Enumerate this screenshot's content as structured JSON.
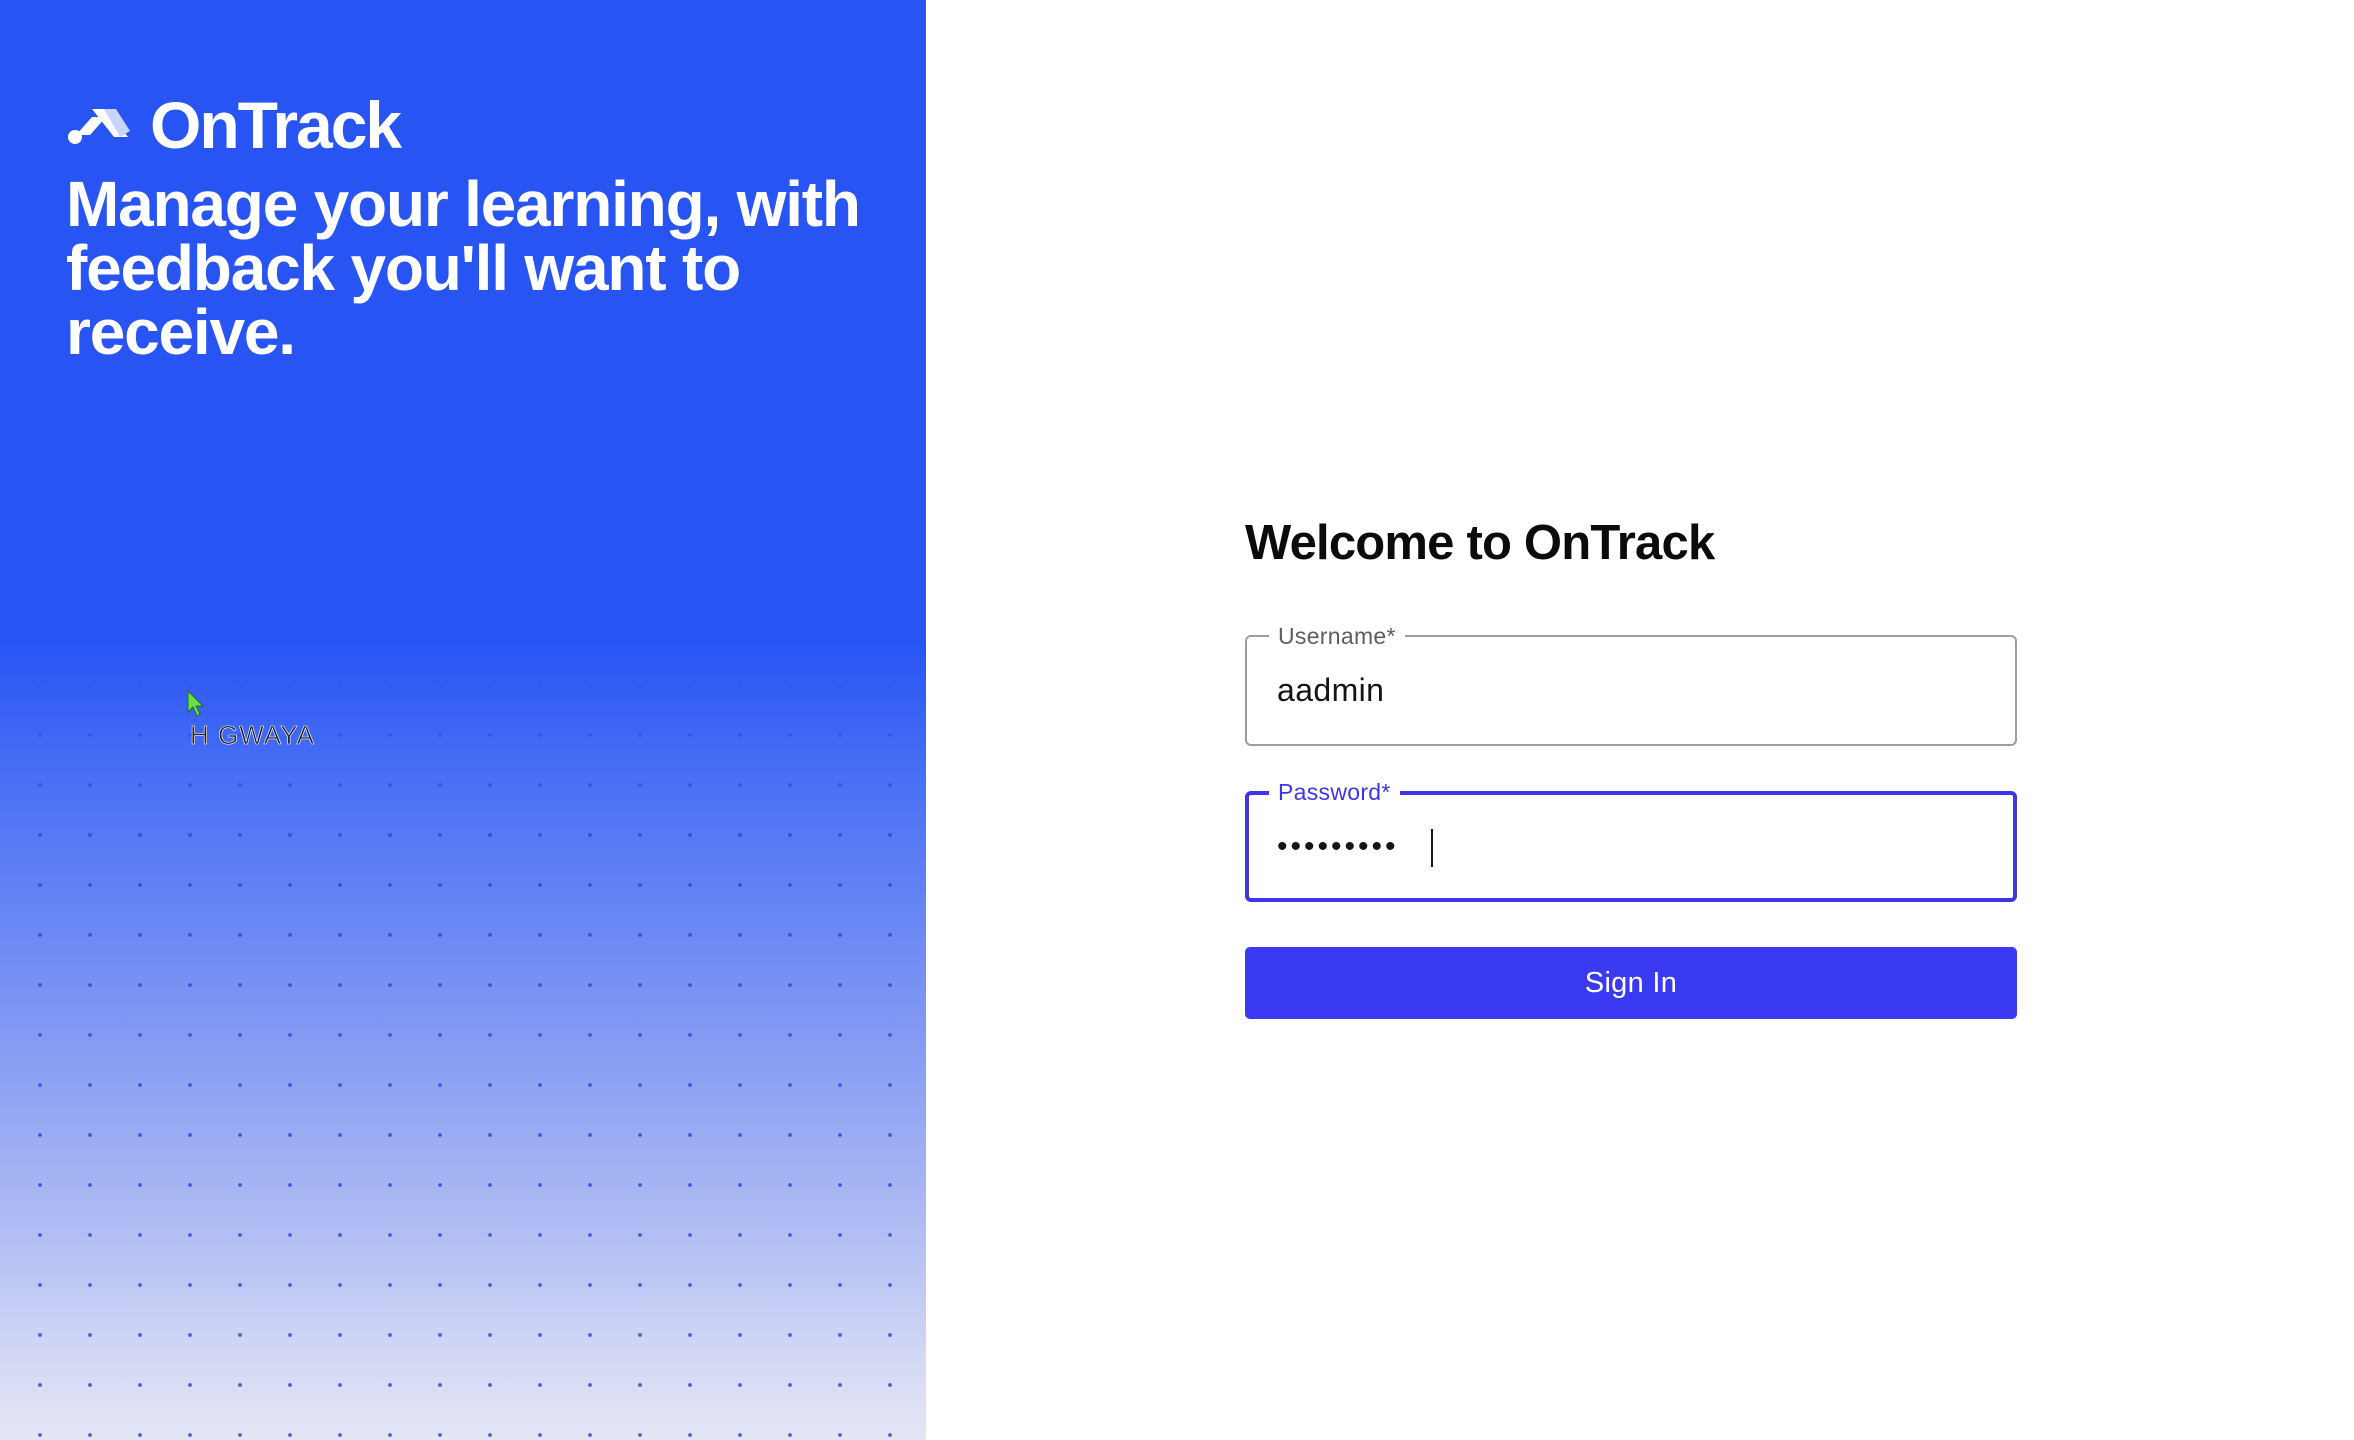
{
  "brand": {
    "name": "OnTrack",
    "icon": "ontrack-logo-icon"
  },
  "hero": {
    "tagline": "Manage your learning, with feedback you'll want to receive.",
    "cursor_label": "H GWAYA"
  },
  "login": {
    "title": "Welcome to OnTrack",
    "username": {
      "label": "Username*",
      "value": "aadmin"
    },
    "password": {
      "label": "Password*",
      "value": "•••••••••"
    },
    "signin_label": "Sign In"
  },
  "colors": {
    "hero_blue": "#2754f3",
    "accent": "#3d35e6",
    "button": "#3a3af3"
  }
}
